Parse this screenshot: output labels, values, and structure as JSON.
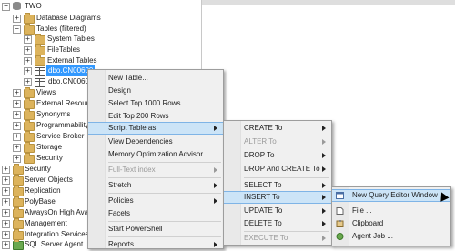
{
  "tree": {
    "server": "TWO",
    "items": [
      {
        "label": "Database Diagrams"
      },
      {
        "label": "Tables (filtered)"
      },
      {
        "label": "System Tables"
      },
      {
        "label": "FileTables"
      },
      {
        "label": "External Tables"
      },
      {
        "label": "dbo.CN00600"
      },
      {
        "label": "dbo.CN00600"
      },
      {
        "label": "Views"
      },
      {
        "label": "External Resource"
      },
      {
        "label": "Synonyms"
      },
      {
        "label": "Programmability"
      },
      {
        "label": "Service Broker"
      },
      {
        "label": "Storage"
      },
      {
        "label": "Security"
      },
      {
        "label": "Security"
      },
      {
        "label": "Server Objects"
      },
      {
        "label": "Replication"
      },
      {
        "label": "PolyBase"
      },
      {
        "label": "AlwaysOn High Availab"
      },
      {
        "label": "Management"
      },
      {
        "label": "Integration Services Cat"
      },
      {
        "label": "SQL Server Agent"
      }
    ]
  },
  "context_menu": {
    "items": [
      {
        "label": "New Table..."
      },
      {
        "label": "Design"
      },
      {
        "label": "Select Top 1000 Rows"
      },
      {
        "label": "Edit Top 200 Rows"
      },
      {
        "label": "Script Table as"
      },
      {
        "label": "View Dependencies"
      },
      {
        "label": "Memory Optimization Advisor"
      },
      {
        "label": "Full-Text index"
      },
      {
        "label": "Stretch"
      },
      {
        "label": "Policies"
      },
      {
        "label": "Facets"
      },
      {
        "label": "Start PowerShell"
      },
      {
        "label": "Reports"
      }
    ]
  },
  "script_menu": {
    "items": [
      {
        "label": "CREATE To"
      },
      {
        "label": "ALTER To"
      },
      {
        "label": "DROP To"
      },
      {
        "label": "DROP And CREATE To"
      },
      {
        "label": "SELECT To"
      },
      {
        "label": "INSERT To"
      },
      {
        "label": "UPDATE To"
      },
      {
        "label": "DELETE To"
      },
      {
        "label": "EXECUTE To"
      }
    ]
  },
  "target_menu": {
    "items": [
      {
        "label": "New Query Editor Window"
      },
      {
        "label": "File ..."
      },
      {
        "label": "Clipboard"
      },
      {
        "label": "Agent Job ..."
      }
    ]
  },
  "colors": {
    "selection": "#3399ff",
    "menu_highlight": "#cce4f7",
    "menu_bg": "#f0f0f0"
  }
}
